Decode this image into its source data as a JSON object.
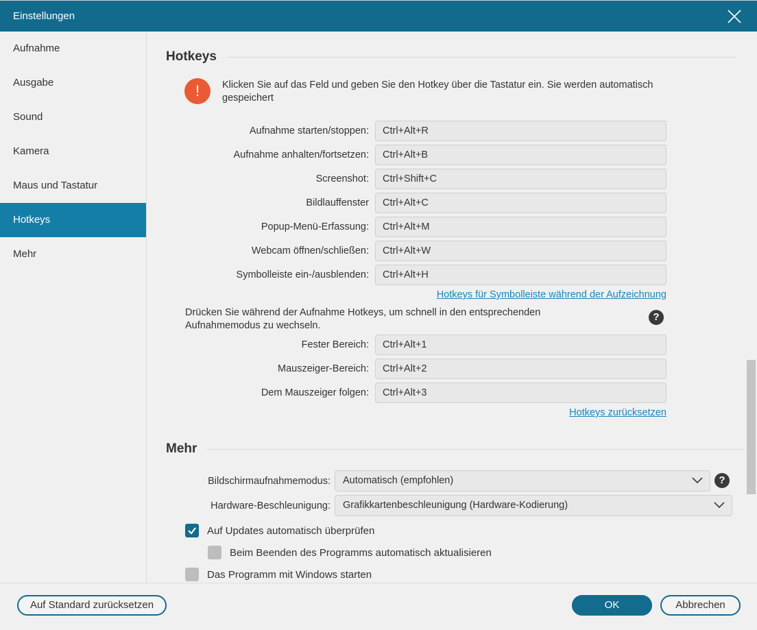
{
  "window": {
    "title": "Einstellungen",
    "close_icon": "close-icon"
  },
  "sidebar": {
    "items": [
      {
        "label": "Aufnahme",
        "active": false
      },
      {
        "label": "Ausgabe",
        "active": false
      },
      {
        "label": "Sound",
        "active": false
      },
      {
        "label": "Kamera",
        "active": false
      },
      {
        "label": "Maus und Tastatur",
        "active": false
      },
      {
        "label": "Hotkeys",
        "active": true
      },
      {
        "label": "Mehr",
        "active": false
      }
    ]
  },
  "hotkeys": {
    "title": "Hotkeys",
    "info_icon": "exclamation-icon",
    "info_text_line1": "Klicken Sie auf das Feld und geben Sie den Hotkey über die Tastatur ein. Sie werden automatisch",
    "info_text_line2": "gespeichert",
    "rows": [
      {
        "label": "Aufnahme starten/stoppen:",
        "value": "Ctrl+Alt+R"
      },
      {
        "label": "Aufnahme anhalten/fortsetzen:",
        "value": "Ctrl+Alt+B"
      },
      {
        "label": "Screenshot:",
        "value": "Ctrl+Shift+C"
      },
      {
        "label": "Bildlauffenster",
        "value": "Ctrl+Alt+C"
      },
      {
        "label": "Popup-Menü-Erfassung:",
        "value": "Ctrl+Alt+M"
      },
      {
        "label": "Webcam öffnen/schließen:",
        "value": "Ctrl+Alt+W"
      },
      {
        "label": "Symbolleiste ein-/ausblenden:",
        "value": "Ctrl+Alt+H"
      }
    ],
    "toolbar_link": "Hotkeys für Symbolleiste während der Aufzeichnung",
    "mode_text_line1": "Drücken Sie während der Aufnahme Hotkeys, um schnell in den entsprechenden",
    "mode_text_line2": "Aufnahmemodus zu wechseln.",
    "mode_rows": [
      {
        "label": "Fester Bereich:",
        "value": "Ctrl+Alt+1"
      },
      {
        "label": "Mauszeiger-Bereich:",
        "value": "Ctrl+Alt+2"
      },
      {
        "label": "Dem Mauszeiger folgen:",
        "value": "Ctrl+Alt+3"
      }
    ],
    "reset_link": "Hotkeys zurücksetzen"
  },
  "more": {
    "title": "Mehr",
    "capture_mode_label": "Bildschirmaufnahmemodus:",
    "capture_mode_value": "Automatisch (empfohlen)",
    "hw_accel_label": "Hardware-Beschleunigung:",
    "hw_accel_value": "Grafikkartenbeschleunigung (Hardware-Kodierung)",
    "checkboxes": [
      {
        "label": "Auf Updates automatisch überprüfen",
        "checked": true
      },
      {
        "label": "Beim Beenden des Programms automatisch aktualisieren",
        "checked": false
      },
      {
        "label": "Das Programm mit Windows starten",
        "checked": false
      }
    ]
  },
  "footer": {
    "reset_default": "Auf Standard zurücksetzen",
    "ok": "OK",
    "cancel": "Abbrechen"
  },
  "colors": {
    "titlebar": "#126b8d",
    "sidebar_active": "#157ea6",
    "accent": "#136b8e",
    "link": "#1a86b8",
    "warning": "#e95b35"
  }
}
